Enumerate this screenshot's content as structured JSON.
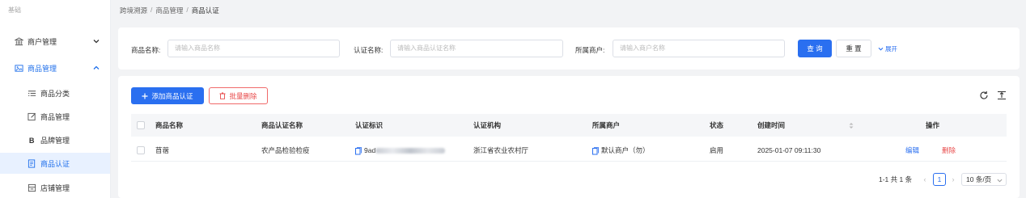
{
  "sidebar": {
    "top_label": "基础",
    "groups": [
      {
        "label": "商户管理",
        "icon": "bank-icon"
      },
      {
        "label": "商品管理",
        "icon": "image-icon"
      }
    ],
    "sub_items": [
      {
        "label": "商品分类",
        "icon": "list-icon"
      },
      {
        "label": "商品管理",
        "icon": "edit-icon"
      },
      {
        "label": "品牌管理",
        "icon": "brand-b-icon"
      },
      {
        "label": "商品认证",
        "icon": "document-icon"
      },
      {
        "label": "店铺管理",
        "icon": "store-icon"
      }
    ]
  },
  "breadcrumb": [
    "跨境溯源",
    "商品管理",
    "商品认证"
  ],
  "search": {
    "fields": [
      {
        "label": "商品名称:",
        "placeholder": "请输入商品名称"
      },
      {
        "label": "认证名称:",
        "placeholder": "请输入商品认证名称"
      },
      {
        "label": "所属商户:",
        "placeholder": "请输入商户名称"
      }
    ],
    "query_label": "查 询",
    "reset_label": "重 置",
    "expand_label": "展开"
  },
  "toolbar": {
    "add_label": "添加商品认证",
    "batch_delete_label": "批量删除"
  },
  "table": {
    "columns": [
      "商品名称",
      "商品认证名称",
      "认证标识",
      "认证机构",
      "所属商户",
      "状态",
      "创建时间",
      "操作"
    ],
    "rows": [
      {
        "product_name": "苜蓿",
        "cert_name": "农产品检验检疫",
        "cert_id_prefix": "9ad",
        "cert_org": "浙江省农业农村厅",
        "merchant": "默认商户（勿）",
        "status": "启用",
        "created_at": "2025-01-07 09:11:30",
        "edit_label": "编辑",
        "delete_label": "删除"
      }
    ]
  },
  "pagination": {
    "total_text": "1-1 共 1 条",
    "current_page": "1",
    "page_size": "10 条/页"
  },
  "colors": {
    "primary": "#2a6ff0",
    "danger": "#e84a4a"
  }
}
